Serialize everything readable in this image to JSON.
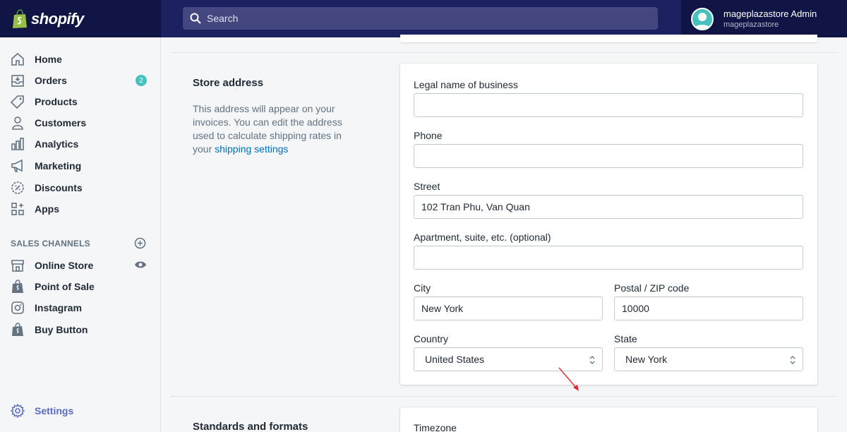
{
  "brand": {
    "name": "shopify"
  },
  "search": {
    "placeholder": "Search"
  },
  "account": {
    "name": "mageplazastore Admin",
    "store": "mageplazastore"
  },
  "sidebar": {
    "items": [
      {
        "label": "Home",
        "icon": "home-icon"
      },
      {
        "label": "Orders",
        "icon": "orders-icon",
        "badge": "2"
      },
      {
        "label": "Products",
        "icon": "tag-icon"
      },
      {
        "label": "Customers",
        "icon": "person-icon"
      },
      {
        "label": "Analytics",
        "icon": "bar-chart-icon"
      },
      {
        "label": "Marketing",
        "icon": "megaphone-icon"
      },
      {
        "label": "Discounts",
        "icon": "discount-icon"
      },
      {
        "label": "Apps",
        "icon": "apps-icon"
      }
    ],
    "channels_heading": "SALES CHANNELS",
    "channels": [
      {
        "label": "Online Store",
        "icon": "store-icon"
      },
      {
        "label": "Point of Sale",
        "icon": "shopify-bag-icon"
      },
      {
        "label": "Instagram",
        "icon": "instagram-icon"
      },
      {
        "label": "Buy Button",
        "icon": "shopify-bag-icon"
      }
    ],
    "settings": {
      "label": "Settings",
      "icon": "gear-icon"
    }
  },
  "store_address": {
    "title": "Store address",
    "description": "This address will appear on your invoices. You can edit the address used to calculate shipping rates in your ",
    "link": "shipping settings",
    "fields": {
      "legal_name": {
        "label": "Legal name of business",
        "value": ""
      },
      "phone": {
        "label": "Phone",
        "value": ""
      },
      "street": {
        "label": "Street",
        "value": "102 Tran Phu, Van Quan"
      },
      "apartment": {
        "label": "Apartment, suite, etc. (optional)",
        "value": ""
      },
      "city": {
        "label": "City",
        "value": "New York"
      },
      "postal": {
        "label": "Postal / ZIP code",
        "value": "10000"
      },
      "country": {
        "label": "Country",
        "value": "United States"
      },
      "state": {
        "label": "State",
        "value": "New York"
      }
    }
  },
  "standards": {
    "title": "Standards and formats",
    "timezone_label": "Timezone"
  },
  "colors": {
    "topbar": "#1c2260",
    "brand_bg": "#0f1444",
    "accent": "#5c6ac4",
    "badge": "#47c1bf",
    "link": "#006fbb"
  }
}
